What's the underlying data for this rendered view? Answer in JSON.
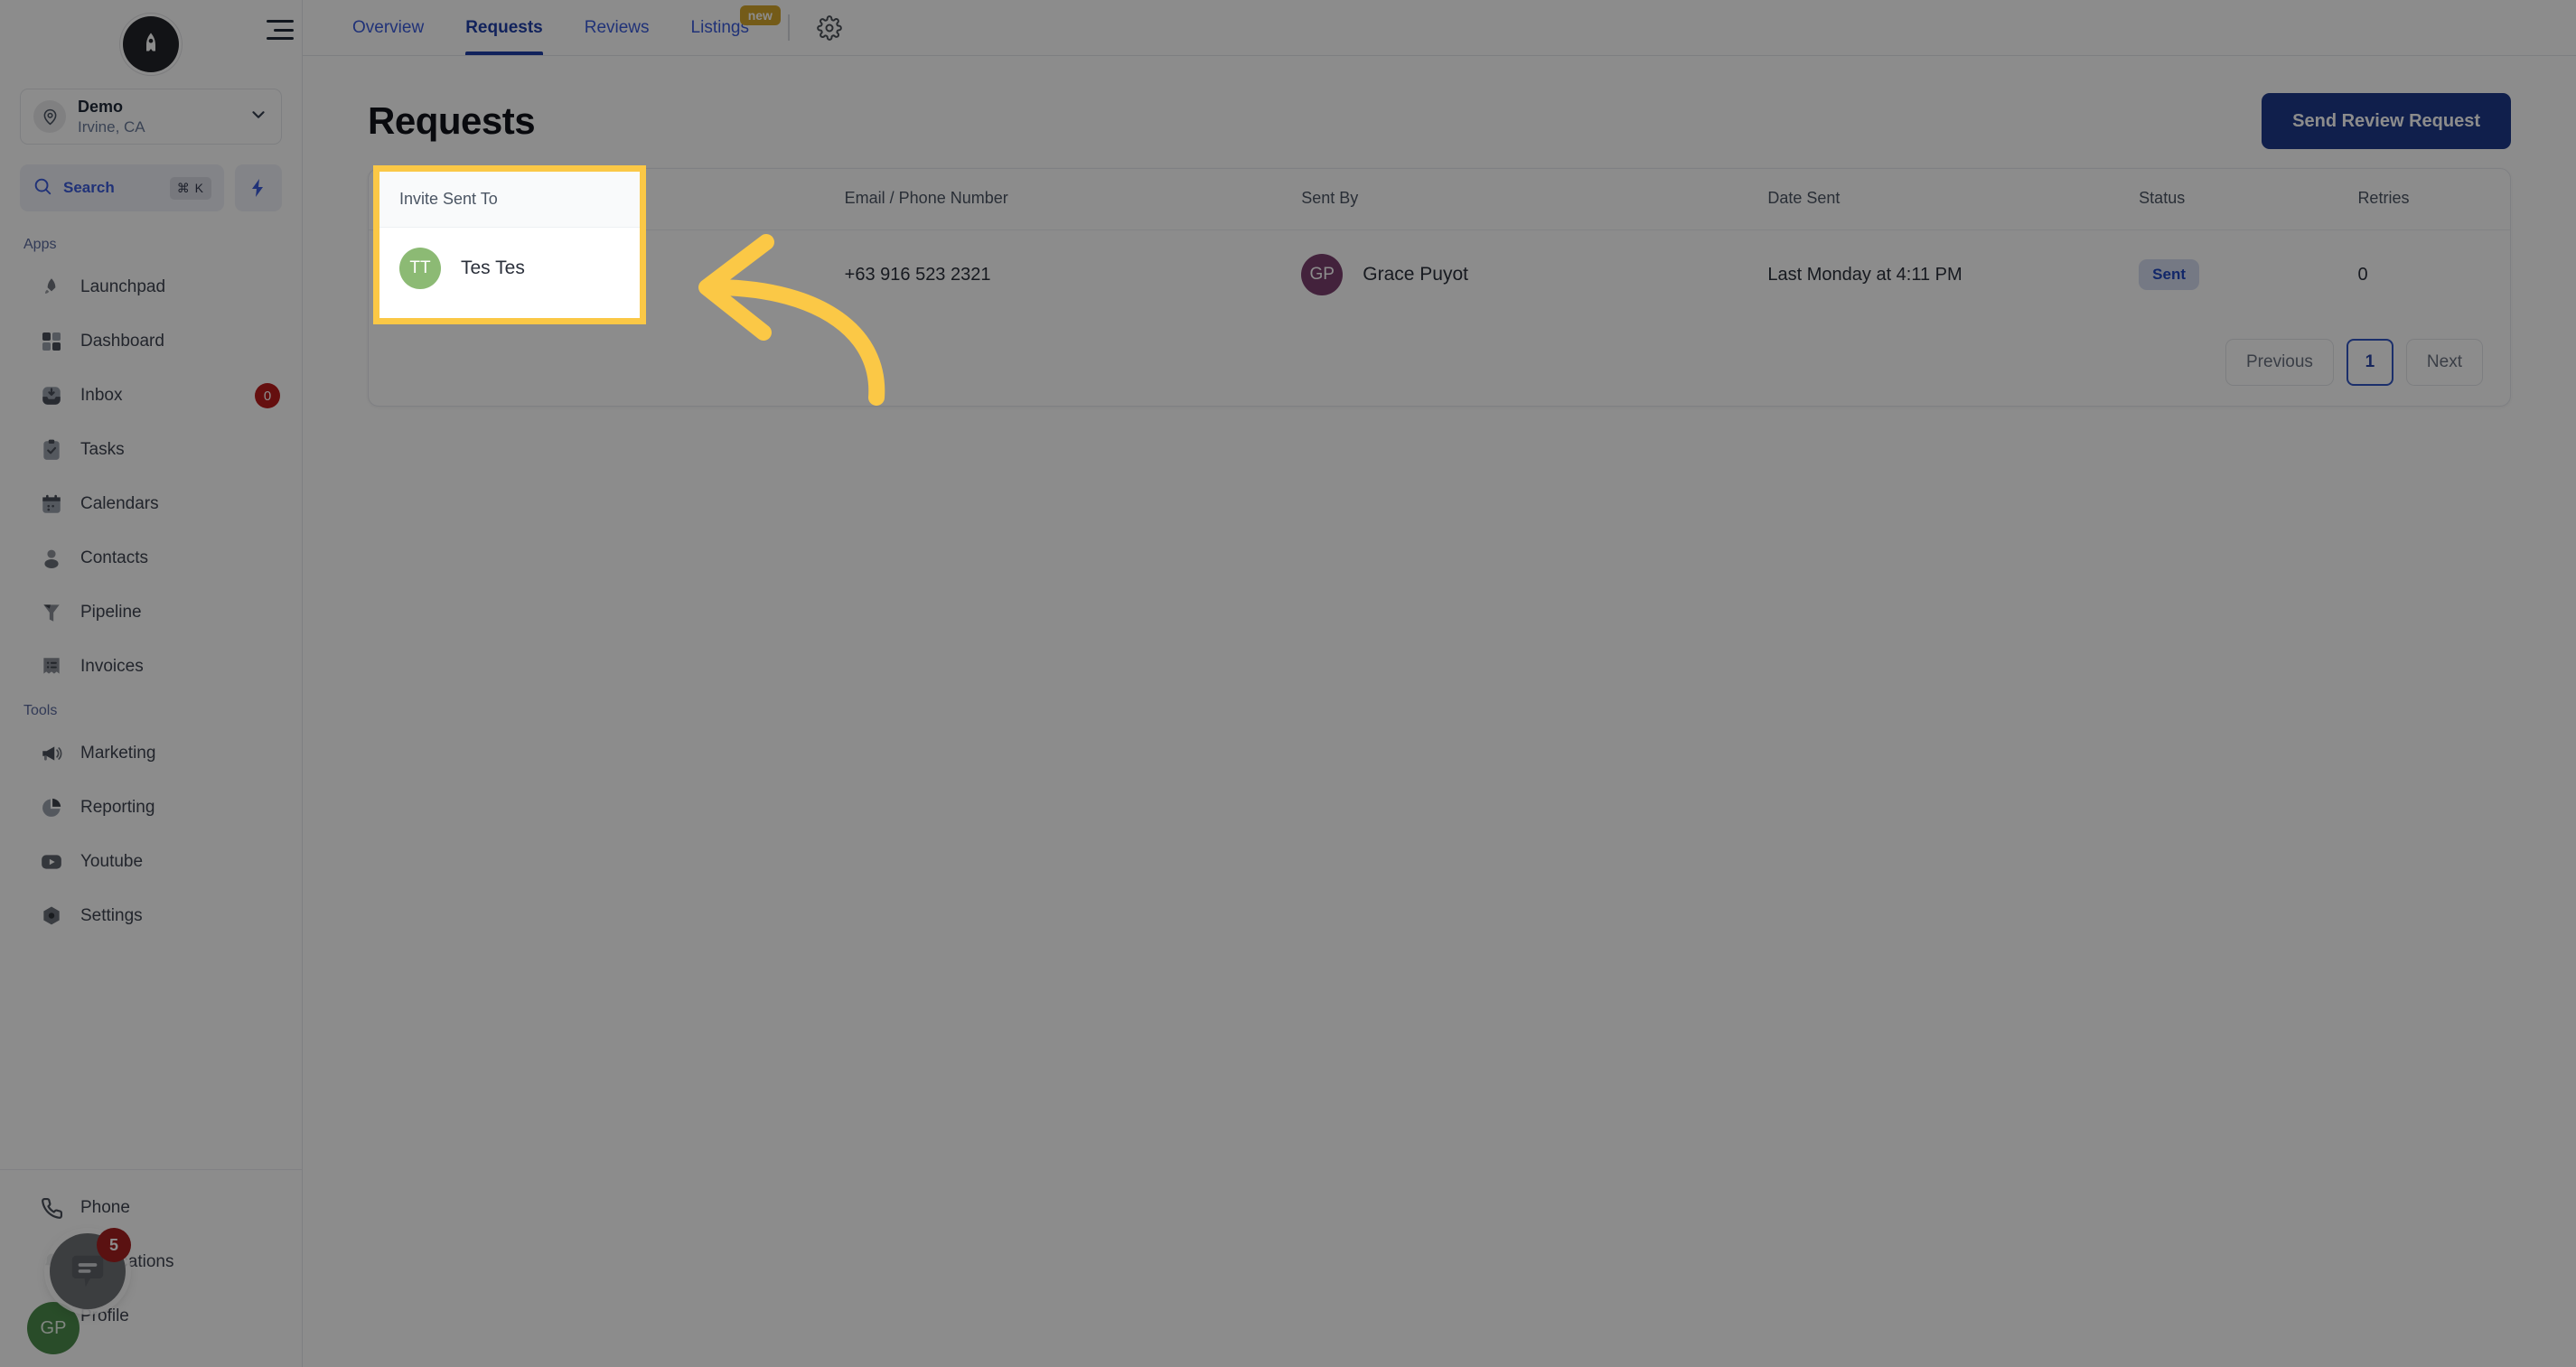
{
  "sidebar": {
    "brand": {
      "logo_letter": "A",
      "icon": "rocket-logo-icon"
    },
    "location": {
      "name": "Demo",
      "sublabel": "Irvine, CA",
      "icon": "map-pin-icon",
      "chevron": "chevron-down-icon"
    },
    "search": {
      "label": "Search",
      "shortcut": "⌘ K",
      "icon": "search-icon"
    },
    "quick_action": {
      "icon": "lightning-bolt-icon"
    },
    "sections": [
      {
        "label": "Apps",
        "items": [
          {
            "label": "Launchpad",
            "icon": "rocket-icon",
            "badge": null
          },
          {
            "label": "Dashboard",
            "icon": "grid-icon",
            "badge": null
          },
          {
            "label": "Inbox",
            "icon": "inbox-icon",
            "badge": "0"
          },
          {
            "label": "Tasks",
            "icon": "clipboard-check-icon",
            "badge": null
          },
          {
            "label": "Calendars",
            "icon": "calendar-icon",
            "badge": null
          },
          {
            "label": "Contacts",
            "icon": "person-icon",
            "badge": null
          },
          {
            "label": "Pipeline",
            "icon": "funnel-icon",
            "badge": null
          },
          {
            "label": "Invoices",
            "icon": "invoice-icon",
            "badge": null
          }
        ]
      },
      {
        "label": "Tools",
        "items": [
          {
            "label": "Marketing",
            "icon": "megaphone-icon",
            "badge": null
          },
          {
            "label": "Reporting",
            "icon": "pie-chart-icon",
            "badge": null
          },
          {
            "label": "Youtube",
            "icon": "youtube-icon",
            "badge": null
          },
          {
            "label": "Settings",
            "icon": "gear-hex-icon",
            "badge": null
          }
        ]
      }
    ],
    "bottom_items": [
      {
        "label": "Phone",
        "icon": "phone-icon",
        "badge": null
      },
      {
        "label": "Notifications",
        "icon": "bell-icon",
        "badge": null
      },
      {
        "label": "Profile",
        "icon": "user-avatar-icon",
        "badge": null
      }
    ],
    "profile_avatar_initials": "GP",
    "chat_widget": {
      "icon": "chat-bubble-icon",
      "badge": "5"
    }
  },
  "topnav": {
    "menu_icon": "hamburger-menu-icon",
    "tabs": [
      {
        "label": "Overview",
        "active": false,
        "badge": null
      },
      {
        "label": "Requests",
        "active": true,
        "badge": null
      },
      {
        "label": "Reviews",
        "active": false,
        "badge": null
      },
      {
        "label": "Listings",
        "active": false,
        "badge": "new"
      }
    ],
    "settings_icon": "gear-icon"
  },
  "main": {
    "title": "Requests",
    "primary_button": "Send Review Request",
    "table": {
      "headers": [
        "Invite Sent To",
        "Email / Phone Number",
        "Sent By",
        "Date Sent",
        "Status",
        "Retries"
      ],
      "rows": [
        {
          "invite_sent_to": "Tes Tes",
          "invite_initials": "TT",
          "email_phone": "+63 916 523 2321",
          "sent_by": "Grace Puyot",
          "sent_by_initials": "GP",
          "date_sent": "Last Monday at 4:11 PM",
          "status": "Sent",
          "retries": "0"
        }
      ]
    },
    "pagination": {
      "previous": "Previous",
      "current_page": "1",
      "next": "Next"
    }
  },
  "highlight": {
    "header": "Invite Sent To",
    "name": "Tes Tes",
    "initials": "TT",
    "border_color": "#fbc846",
    "avatar_color": "#8cba74"
  },
  "annotation": {
    "arrow_color": "#fbc846",
    "shape": "curved-left-arrow"
  },
  "colors": {
    "accent_blue": "#1e3a8a",
    "link_blue": "#3b5bdb",
    "badge_red": "#b91c1c",
    "badge_gold": "#d4a72c",
    "status_pill_bg": "#d6dcf0",
    "status_pill_text": "#2148c0",
    "sent_by_avatar": "#7b3f6e"
  }
}
